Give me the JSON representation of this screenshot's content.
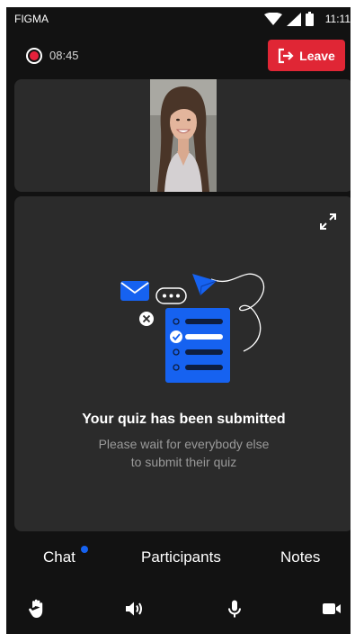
{
  "status_bar": {
    "carrier": "FIGMA",
    "time": "11:11"
  },
  "call": {
    "timer": "08:45",
    "leave_label": "Leave"
  },
  "quiz": {
    "title": "Your quiz has been submitted",
    "subtitle_line1": "Please wait for everybody else",
    "subtitle_line2": "to submit their quiz"
  },
  "tabs": [
    {
      "label": "Chat",
      "has_unread": true
    },
    {
      "label": "Participants"
    },
    {
      "label": "Notes"
    }
  ],
  "bottom_bar": {
    "icons": [
      "raise-hand-icon",
      "speaker-icon",
      "microphone-icon",
      "video-camera-icon"
    ]
  },
  "colors": {
    "accent": "#1662f0",
    "leave": "#e02635",
    "record": "#e5213b",
    "panel": "#2b2b2b",
    "background": "#121212"
  }
}
